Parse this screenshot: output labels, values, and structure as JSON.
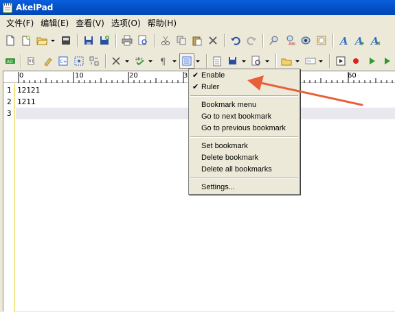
{
  "window": {
    "title": "AkelPad"
  },
  "menu": [
    "文件(F)",
    "编辑(E)",
    "查看(V)",
    "选项(O)",
    "帮助(H)"
  ],
  "ruler": {
    "labels": [
      "0",
      "10",
      "20",
      "3",
      "60"
    ]
  },
  "editor": {
    "line_numbers": [
      "1",
      "2",
      "3"
    ],
    "lines": [
      "12121",
      "1211",
      ""
    ]
  },
  "popup_menu": {
    "enable": "Enable",
    "ruler": "Ruler",
    "bookmark_menu": "Bookmark menu",
    "next_bookmark": "Go to next bookmark",
    "prev_bookmark": "Go to previous bookmark",
    "set_bookmark": "Set bookmark",
    "delete_bookmark": "Delete bookmark",
    "delete_all": "Delete all bookmarks",
    "settings": "Settings..."
  },
  "annotation": {
    "color": "#e8603a"
  },
  "icons": [
    "new-file-icon",
    "new-window-icon",
    "open-folder-icon",
    "recent-icon",
    "save-icon",
    "save-all-icon",
    "print-icon",
    "print-preview-icon",
    "cut-icon",
    "copy-icon",
    "paste-icon",
    "delete-icon",
    "undo-icon",
    "redo-icon",
    "find-icon",
    "replace-icon",
    "goto-icon",
    "font-icon",
    "text-bold-icon",
    "text-color-icon"
  ]
}
